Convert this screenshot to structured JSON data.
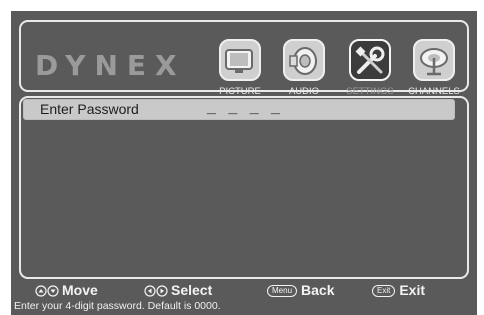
{
  "brand": {
    "logo_text": "DYNEX"
  },
  "menu": {
    "tabs": [
      {
        "label": "PICTURE",
        "icon": "tv-icon"
      },
      {
        "label": "AUDIO",
        "icon": "speaker-icon"
      },
      {
        "label": "SETTINGS",
        "icon": "settings-tools-icon",
        "active": true
      },
      {
        "label": "CHANNELS",
        "icon": "satellite-dish-icon"
      }
    ]
  },
  "content": {
    "row_label": "Enter Password",
    "password_placeholder": "_ _ _ _"
  },
  "help": {
    "move_label": "Move",
    "select_label": "Select",
    "back_label": "Back",
    "back_key": "Menu",
    "exit_label": "Exit",
    "exit_key": "Exit"
  },
  "hint_text": "Enter your 4-digit password. Default is 0000.",
  "colors": {
    "screen_bg": "#5a5a5a",
    "highlight_row": "#c9c9c9",
    "frame": "#e9e9e9",
    "active_tab": "#3c3c3c"
  }
}
